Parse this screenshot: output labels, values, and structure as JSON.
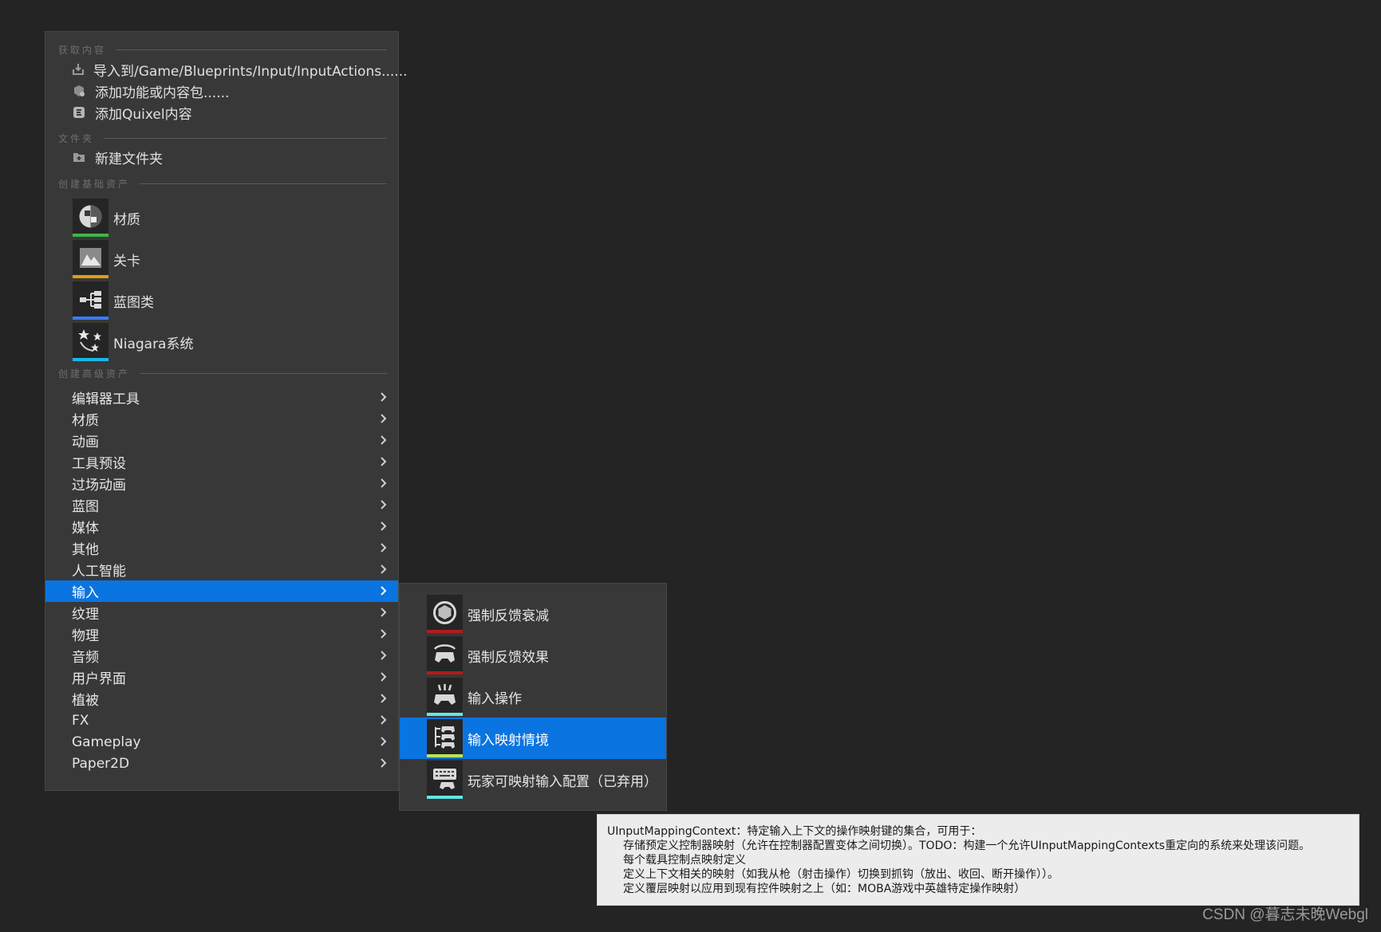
{
  "menu": {
    "sections": {
      "get_content": "获取内容",
      "folder": "文件夹",
      "basic_assets": "创建基础资产",
      "advanced_assets": "创建高级资产"
    },
    "get_content_items": [
      {
        "label": "导入到/Game/Blueprints/Input/InputActions......",
        "icon": "import-icon"
      },
      {
        "label": "添加功能或内容包......",
        "icon": "content-pack-icon"
      },
      {
        "label": "添加Quixel内容",
        "icon": "quixel-icon"
      }
    ],
    "folder_items": [
      {
        "label": "新建文件夹",
        "icon": "folder-add-icon"
      }
    ],
    "basic_assets": [
      {
        "label": "材质",
        "icon": "material-icon",
        "color": "#3fb545"
      },
      {
        "label": "关卡",
        "icon": "level-icon",
        "color": "#e39a12"
      },
      {
        "label": "蓝图类",
        "icon": "blueprint-icon",
        "color": "#3b7cf0"
      },
      {
        "label": "Niagara系统",
        "icon": "niagara-icon",
        "color": "#18b6e8"
      }
    ],
    "advanced_categories": [
      "编辑器工具",
      "材质",
      "动画",
      "工具预设",
      "过场动画",
      "蓝图",
      "媒体",
      "其他",
      "人工智能",
      "输入",
      "纹理",
      "物理",
      "音频",
      "用户界面",
      "植被",
      "FX",
      "Gameplay",
      "Paper2D"
    ],
    "selected_category": "输入"
  },
  "submenu": {
    "items": [
      {
        "label": "强制反馈衰减",
        "icon": "force-feedback-attenuation-icon",
        "color": "#b31b1b"
      },
      {
        "label": "强制反馈效果",
        "icon": "force-feedback-effect-icon",
        "color": "#b31b1b"
      },
      {
        "label": "输入操作",
        "icon": "input-action-icon",
        "color": "#62e6e6"
      },
      {
        "label": "输入映射情境",
        "icon": "input-mapping-context-icon",
        "color": "#b8e35a"
      },
      {
        "label": "玩家可映射输入配置（已弃用）",
        "icon": "player-mappable-config-icon",
        "color": "#62e6e6"
      }
    ],
    "selected": "输入映射情境"
  },
  "tooltip": {
    "lines": [
      "UInputMappingContext：特定输入上下文的操作映射键的集合，可用于：",
      "存储预定义控制器映射（允许在控制器配置变体之间切换）。TODO：构建一个允许UInputMappingContexts重定向的系统来处理该问题。",
      "每个载具控制点映射定义",
      "定义上下文相关的映射（如我从枪（射击操作）切换到抓钩（放出、收回、断开操作））。",
      "定义覆层映射以应用到现有控件映射之上（如：MOBA游戏中英雄特定操作映射）"
    ]
  },
  "watermark": "CSDN @暮志未晚Webgl",
  "colors": {
    "background": "#242424",
    "menu": "#383838",
    "selection": "#0a74e0",
    "tooltip_bg": "#ececec"
  }
}
